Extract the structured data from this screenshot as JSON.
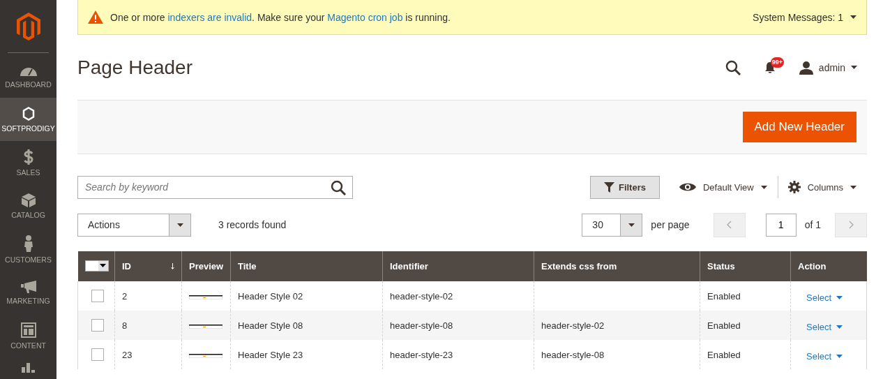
{
  "sidebar": {
    "items": [
      {
        "kind": "dashboard",
        "label": "DASHBOARD",
        "selected": false
      },
      {
        "kind": "hexagon",
        "label": "SOFTPRODIGY",
        "selected": true
      },
      {
        "kind": "dollar",
        "label": "SALES",
        "selected": false
      },
      {
        "kind": "box",
        "label": "CATALOG",
        "selected": false
      },
      {
        "kind": "person",
        "label": "CUSTOMERS",
        "selected": false
      },
      {
        "kind": "megaphone",
        "label": "MARKETING",
        "selected": false
      },
      {
        "kind": "layout",
        "label": "CONTENT",
        "selected": false
      },
      {
        "kind": "bars",
        "selected": false
      }
    ]
  },
  "system_message": {
    "parts": [
      {
        "kind": "text",
        "text": "One or more "
      },
      {
        "kind": "link",
        "text": "indexers are invalid"
      },
      {
        "kind": "text",
        "text": ". Make sure your "
      },
      {
        "kind": "link",
        "text": "Magento cron job"
      },
      {
        "kind": "text",
        "text": " is running."
      }
    ],
    "counter": "System Messages: 1"
  },
  "page_title": "Page Header",
  "notifications_badge": "99+",
  "user": "admin",
  "add_button": "Add New Header",
  "search": {
    "placeholder": "Search by keyword"
  },
  "filters_button": "Filters",
  "view": "Default View",
  "columns_button": "Columns",
  "actions_select": "Actions",
  "records_found": "3 records found",
  "per_page": {
    "value": "30",
    "label": "per page"
  },
  "pager": {
    "page": "1",
    "of": "of 1"
  },
  "table": {
    "select_all_checked": false,
    "columns": [
      "ID",
      "Preview",
      "Title",
      "Identifier",
      "Extends css from",
      "Status",
      "Action"
    ],
    "rows": [
      {
        "checked": false,
        "id": "2",
        "title": "Header Style 02",
        "identifier": "header-style-02",
        "status": "Enabled",
        "action": "Select"
      },
      {
        "checked": false,
        "id": "8",
        "title": "Header Style 08",
        "identifier": "header-style-08",
        "extends": "header-style-02",
        "status": "Enabled",
        "action": "Select"
      },
      {
        "checked": false,
        "id": "23",
        "title": "Header Style 23",
        "identifier": "header-style-23",
        "extends": "header-style-08",
        "status": "Enabled",
        "action": "Select"
      }
    ]
  }
}
